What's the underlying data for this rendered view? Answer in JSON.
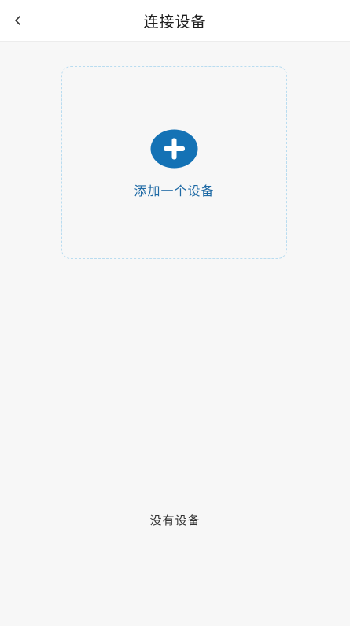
{
  "header": {
    "title": "连接设备",
    "back_icon": "chevron-left-icon"
  },
  "add_card": {
    "label": "添加一个设备",
    "icon": "plus-circle-icon",
    "accent_color": "#1472b5"
  },
  "empty_state": {
    "message": "没有设备"
  }
}
